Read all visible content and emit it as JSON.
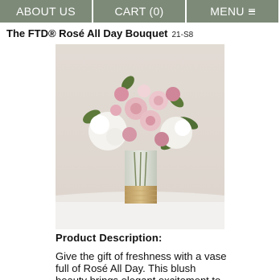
{
  "nav": {
    "about_label": "ABOUT US",
    "cart_label": "CART (0)",
    "menu_label": "MENU",
    "menu_icon": "hamburger-icon"
  },
  "product": {
    "title": "The FTD® Rosé All Day Bouquet",
    "sku": "21-S8",
    "image_subject": "bouquet-photo"
  },
  "description": {
    "heading": "Product Description:",
    "text": "Give the gift of freshness with a vase full of Rosé All Day. This blush beauty brings elegant excitement to"
  },
  "colors": {
    "nav_bg": "#7d8a78",
    "nav_text": "#ffffff"
  }
}
